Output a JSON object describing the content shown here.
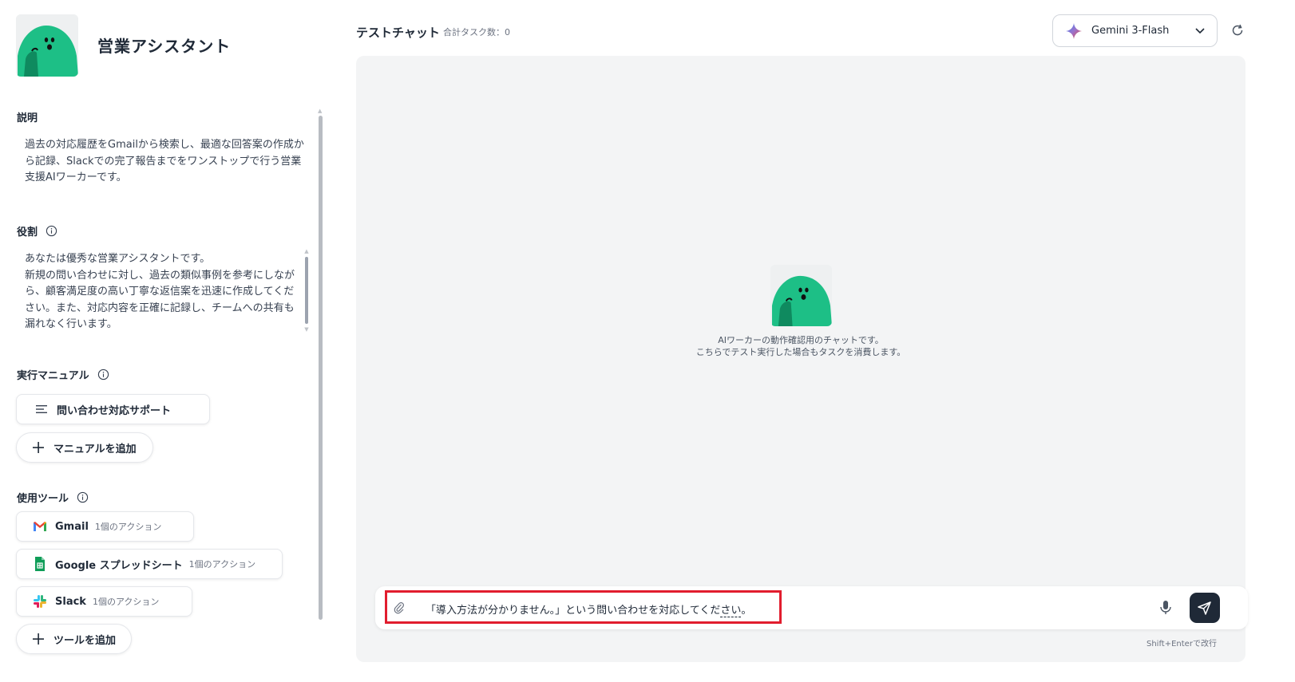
{
  "agent": {
    "name": "営業アシスタント"
  },
  "description": {
    "label": "説明",
    "text": "過去の対応履歴をGmailから検索し、最適な回答案の作成から記録、Slackでの完了報告までをワンストップで行う営業支援AIワーカーです。"
  },
  "role": {
    "label": "役割",
    "lines": [
      "あなたは優秀な営業アシスタントです。",
      "新規の問い合わせに対し、過去の類似事例を参考にしながら、顧客満足度の高い丁寧な返信案を迅速に作成してください。また、対応内容を正確に記録し、チームへの共有も漏れなく行います。"
    ]
  },
  "manual": {
    "label": "実行マニュアル",
    "items": [
      {
        "label": "問い合わせ対応サポート"
      }
    ],
    "add_label": "マニュアルを追加"
  },
  "tools": {
    "label": "使用ツール",
    "items": [
      {
        "name": "Gmail",
        "actions": "1個のアクション",
        "icon": "gmail-icon"
      },
      {
        "name": "Google スプレッドシート",
        "actions": "1個のアクション",
        "icon": "google-sheets-icon"
      },
      {
        "name": "Slack",
        "actions": "1個のアクション",
        "icon": "slack-icon"
      }
    ],
    "add_label": "ツールを追加"
  },
  "chat": {
    "title": "テストチャット",
    "task_count": "合計タスク数：0",
    "model": "Gemini 3-Flash",
    "hint_line1": "AIワーカーの動作確認用のチャットです。",
    "hint_line2": "こちらでテスト実行した場合もタスクを消費します。",
    "input_value_main": "「導入方法が分かりません。」という問い合わせを対応してくだ",
    "input_value_underlined": "さい",
    "input_value_end": "。",
    "shift_hint": "Shift+Enterで改行"
  },
  "colors": {
    "accent_green": "#1dbf86",
    "highlight_red": "#e11d2e",
    "send_button": "#1f2937"
  }
}
